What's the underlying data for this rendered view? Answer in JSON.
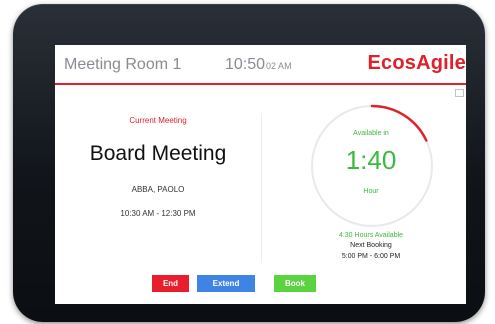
{
  "header": {
    "room_name": "Meeting Room 1",
    "time": "10:50",
    "ampm": "02 AM",
    "brand": "EcosAgile"
  },
  "current_meeting": {
    "label": "Current Meeting",
    "title": "Board Meeting",
    "organizer": "ABBA, PAOLO",
    "time_range": "10:30 AM - 12:30 PM"
  },
  "availability": {
    "label": "Available in",
    "countdown": "1:40",
    "unit": "Hour",
    "hours_available": "4:30 Hours Available",
    "next_booking_label": "Next Booking",
    "next_booking_time": "5:00 PM - 6:00 PM",
    "ring_progress": 0.18
  },
  "buttons": {
    "end": "End",
    "extend": "Extend",
    "book": "Book"
  },
  "colors": {
    "accent_red": "#e0202a",
    "available_green": "#3cb93f",
    "extend_blue": "#3f84e5",
    "book_green": "#5bd341"
  }
}
